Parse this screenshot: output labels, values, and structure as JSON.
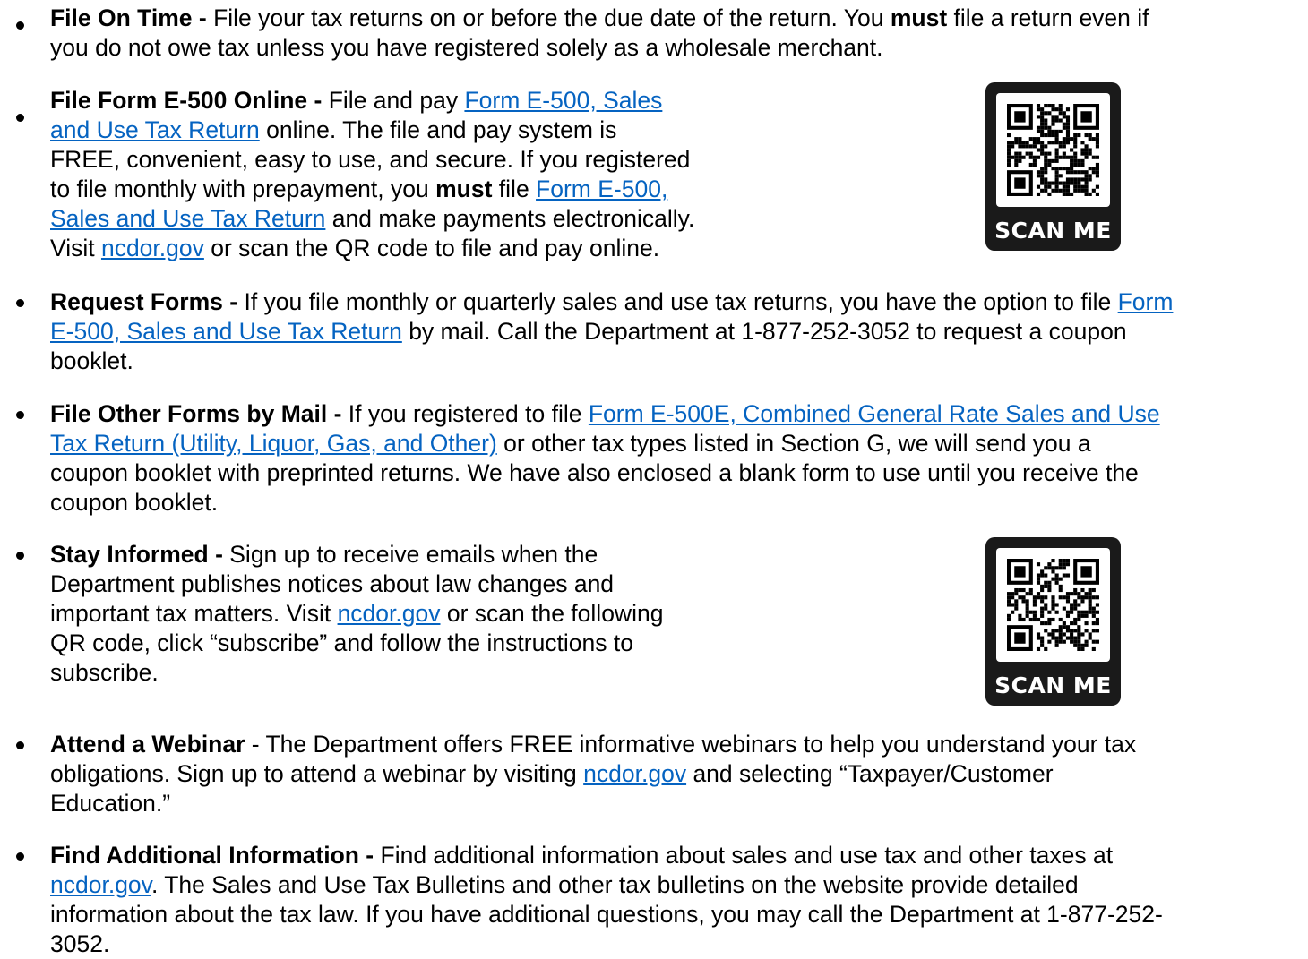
{
  "items": [
    {
      "bold": "File On Time -",
      "lines": [
        [
          {
            "t": " File your tax returns on or before the due date of the return.  You "
          },
          {
            "t": "must",
            "b": true
          },
          {
            "t": " file a return even if"
          }
        ],
        [
          {
            "t": "you do not owe tax unless you have registered solely as a wholesale merchant."
          }
        ]
      ]
    },
    {
      "bold": "File Form E-500 Online -",
      "lines": [
        [
          {
            "t": " File and pay "
          },
          {
            "t": "Form E-500, Sales",
            "l": true
          }
        ],
        [
          {
            "t": "and Use Tax Return",
            "l": true
          },
          {
            "t": " online.  The file and pay system is"
          }
        ],
        [
          {
            "t": "FREE, convenient, easy to use, and secure.  If you registered"
          }
        ],
        [
          {
            "t": "to file monthly with prepayment, you "
          },
          {
            "t": "must",
            "b": true
          },
          {
            "t": " file "
          },
          {
            "t": "Form E-500,",
            "l": true
          }
        ],
        [
          {
            "t": "Sales and Use Tax Return",
            "l": true
          },
          {
            "t": " and make payments electronically."
          }
        ],
        [
          {
            "t": "Visit "
          },
          {
            "t": "ncdor.gov",
            "l": true
          },
          {
            "t": " or scan the QR code to file and pay online."
          }
        ]
      ]
    },
    {
      "bold": "Request Forms -",
      "lines": [
        [
          {
            "t": " If you file monthly or quarterly sales and use tax returns, you have the option to file "
          },
          {
            "t": "Form",
            "l": true
          }
        ],
        [
          {
            "t": "E-500, Sales and Use Tax Return",
            "l": true
          },
          {
            "t": " by mail.  Call the Department at 1-877-252-3052 to request a coupon"
          }
        ],
        [
          {
            "t": "booklet."
          }
        ]
      ]
    },
    {
      "bold": "File Other Forms by Mail -",
      "lines": [
        [
          {
            "t": " If you registered to file "
          },
          {
            "t": "Form E-500E, Combined General Rate Sales and Use",
            "l": true
          }
        ],
        [
          {
            "t": "Tax Return (Utility, Liquor, Gas, and Other)",
            "l": true
          },
          {
            "t": " or other tax types listed in Section G, we will send you a"
          }
        ],
        [
          {
            "t": "coupon booklet with preprinted returns.  We have also enclosed a blank form to use until you receive the"
          }
        ],
        [
          {
            "t": "coupon booklet."
          }
        ]
      ]
    },
    {
      "bold": "Stay Informed -",
      "lines": [
        [
          {
            "t": " Sign up to receive emails when the"
          }
        ],
        [
          {
            "t": "Department publishes notices about law changes and"
          }
        ],
        [
          {
            "t": "important tax matters.  Visit "
          },
          {
            "t": "ncdor.gov",
            "l": true
          },
          {
            "t": " or scan the following"
          }
        ],
        [
          {
            "t": "QR code, click “subscribe” and follow the instructions to"
          }
        ],
        [
          {
            "t": "subscribe."
          }
        ]
      ]
    },
    {
      "bold": "Attend a Webinar",
      "lines": [
        [
          {
            "t": " - The Department offers FREE informative webinars to help you understand your tax"
          }
        ],
        [
          {
            "t": "obligations.  Sign up to attend a webinar by visiting "
          },
          {
            "t": "ncdor.gov",
            "l": true
          },
          {
            "t": " and selecting “Taxpayer/Customer"
          }
        ],
        [
          {
            "t": "Education.”"
          }
        ]
      ]
    },
    {
      "bold": "Find Additional Information -",
      "lines": [
        [
          {
            "t": " Find additional information about sales and use tax and other taxes at"
          }
        ],
        [
          {
            "t": "ncdor.gov",
            "l": true
          },
          {
            "t": ".  The Sales and Use Tax Bulletins and other tax bulletins on the website provide detailed"
          }
        ],
        [
          {
            "t": "information about the tax law.  If you have additional questions, you may call the Department at 1-877-252-"
          }
        ],
        [
          {
            "t": "3052."
          }
        ]
      ]
    }
  ],
  "qr_codes": [
    {
      "label": "SCAN ME"
    },
    {
      "label": "SCAN ME"
    }
  ]
}
